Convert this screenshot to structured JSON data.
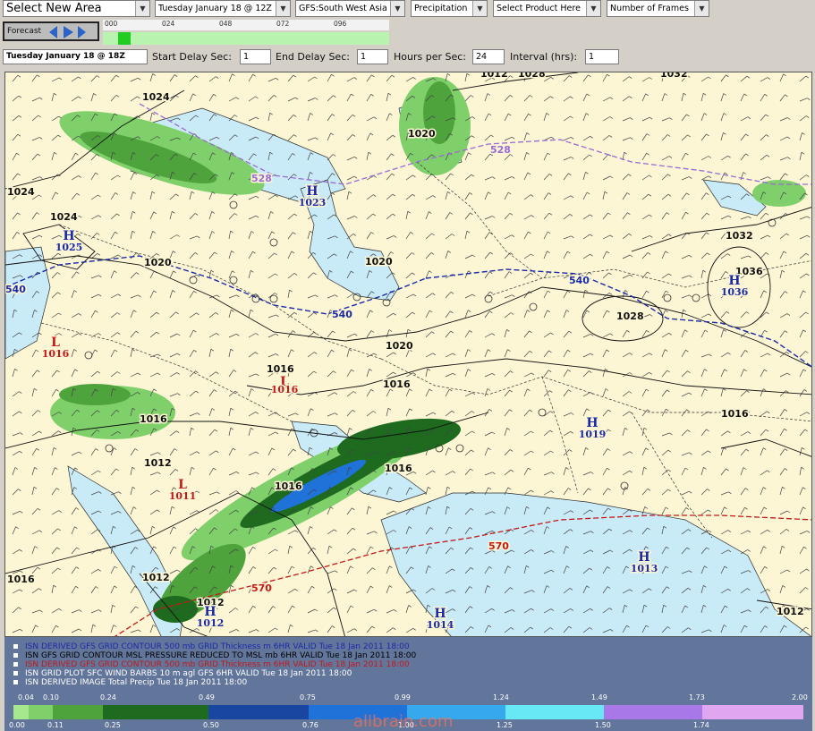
{
  "toolbar": {
    "area_select": "Select New Area",
    "time_select": "Tuesday January 18 @ 12Z",
    "model_select": "GFS:South West Asia",
    "param_select": "Precipitation",
    "product_select": "Select Product Here",
    "frames_select": "Number of Frames"
  },
  "forecast": {
    "label": "Forecast",
    "hours": [
      "000",
      "024",
      "048",
      "072",
      "096"
    ]
  },
  "controls": {
    "valid_time": "Tuesday January 18 @ 18Z",
    "start_delay_label": "Start Delay Sec:",
    "start_delay_value": "1",
    "end_delay_label": "End Delay Sec:",
    "end_delay_value": "1",
    "hours_per_sec_label": "Hours per Sec:",
    "hours_per_sec_value": "24",
    "interval_label": "Interval (hrs):",
    "interval_value": "1"
  },
  "map": {
    "isobar_labels": [
      "1024",
      "1024",
      "1024",
      "1020",
      "1020",
      "1020",
      "1016",
      "1016",
      "1016",
      "1016",
      "1016",
      "1012",
      "1012",
      "1012",
      "1012",
      "1016",
      "1028",
      "1028",
      "1032",
      "1032",
      "1016",
      "1012"
    ],
    "thickness_labels": [
      "528",
      "528",
      "540",
      "540",
      "540",
      "570",
      "570"
    ],
    "highs": [
      {
        "letter": "H",
        "value": "1023"
      },
      {
        "letter": "H",
        "value": "1025"
      },
      {
        "letter": "H",
        "value": "1036"
      },
      {
        "letter": "H",
        "value": "1019"
      },
      {
        "letter": "H",
        "value": "1013"
      },
      {
        "letter": "H",
        "value": "1014"
      },
      {
        "letter": "H",
        "value": "1012"
      }
    ],
    "lows": [
      {
        "letter": "L",
        "value": "1016"
      },
      {
        "letter": "L",
        "value": "1016"
      },
      {
        "letter": "L",
        "value": "1011"
      }
    ],
    "other_labels": [
      "1020",
      "1036",
      "1016",
      "1016"
    ]
  },
  "legend": {
    "lines": [
      {
        "text": "ISN DERIVED GFS GRID CONTOUR 500 mb GRID Thickness m 6HR VALID Tue 18 Jan 2011 18:00",
        "color": "#1a2aa8"
      },
      {
        "text": "ISN GFS GRID CONTOUR MSL PRESSURE REDUCED TO MSL mb 6HR VALID Tue 18 Jan 2011 18:00",
        "color": "#000000"
      },
      {
        "text": "ISN DERIVED GFS GRID CONTOUR 500 mb GRID Thickness m 6HR VALID Tue 18 Jan 2011 18:00",
        "color": "#c41818"
      },
      {
        "text": "ISN GRID PLOT SFC WIND BARBS 10 m agl GFS 6HR VALID Tue 18 Jan 2011 18:00",
        "color": "#ffffff"
      },
      {
        "text": "ISN DERIVED IMAGE Total Precip Tue 18 Jan 2011 18:00",
        "color": "#ffffff"
      }
    ]
  },
  "scale": {
    "top_labels": [
      "0.04",
      "0.10",
      "0.24",
      "0.49",
      "0.75",
      "0.99",
      "1.24",
      "1.49",
      "1.73",
      "2.00"
    ],
    "bottom_labels": [
      "0.00",
      "0.11",
      "0.25",
      "0.50",
      "0.76",
      "1.00",
      "1.25",
      "1.50",
      "1.74"
    ],
    "colors": [
      "#a6e88e",
      "#7fd06a",
      "#4ea33c",
      "#1e6a1e",
      "#1846a0",
      "#1e72d8",
      "#36a8ee",
      "#68e8f4",
      "#a878e8",
      "#e0a6f0"
    ]
  },
  "watermark": "allbrain.com"
}
